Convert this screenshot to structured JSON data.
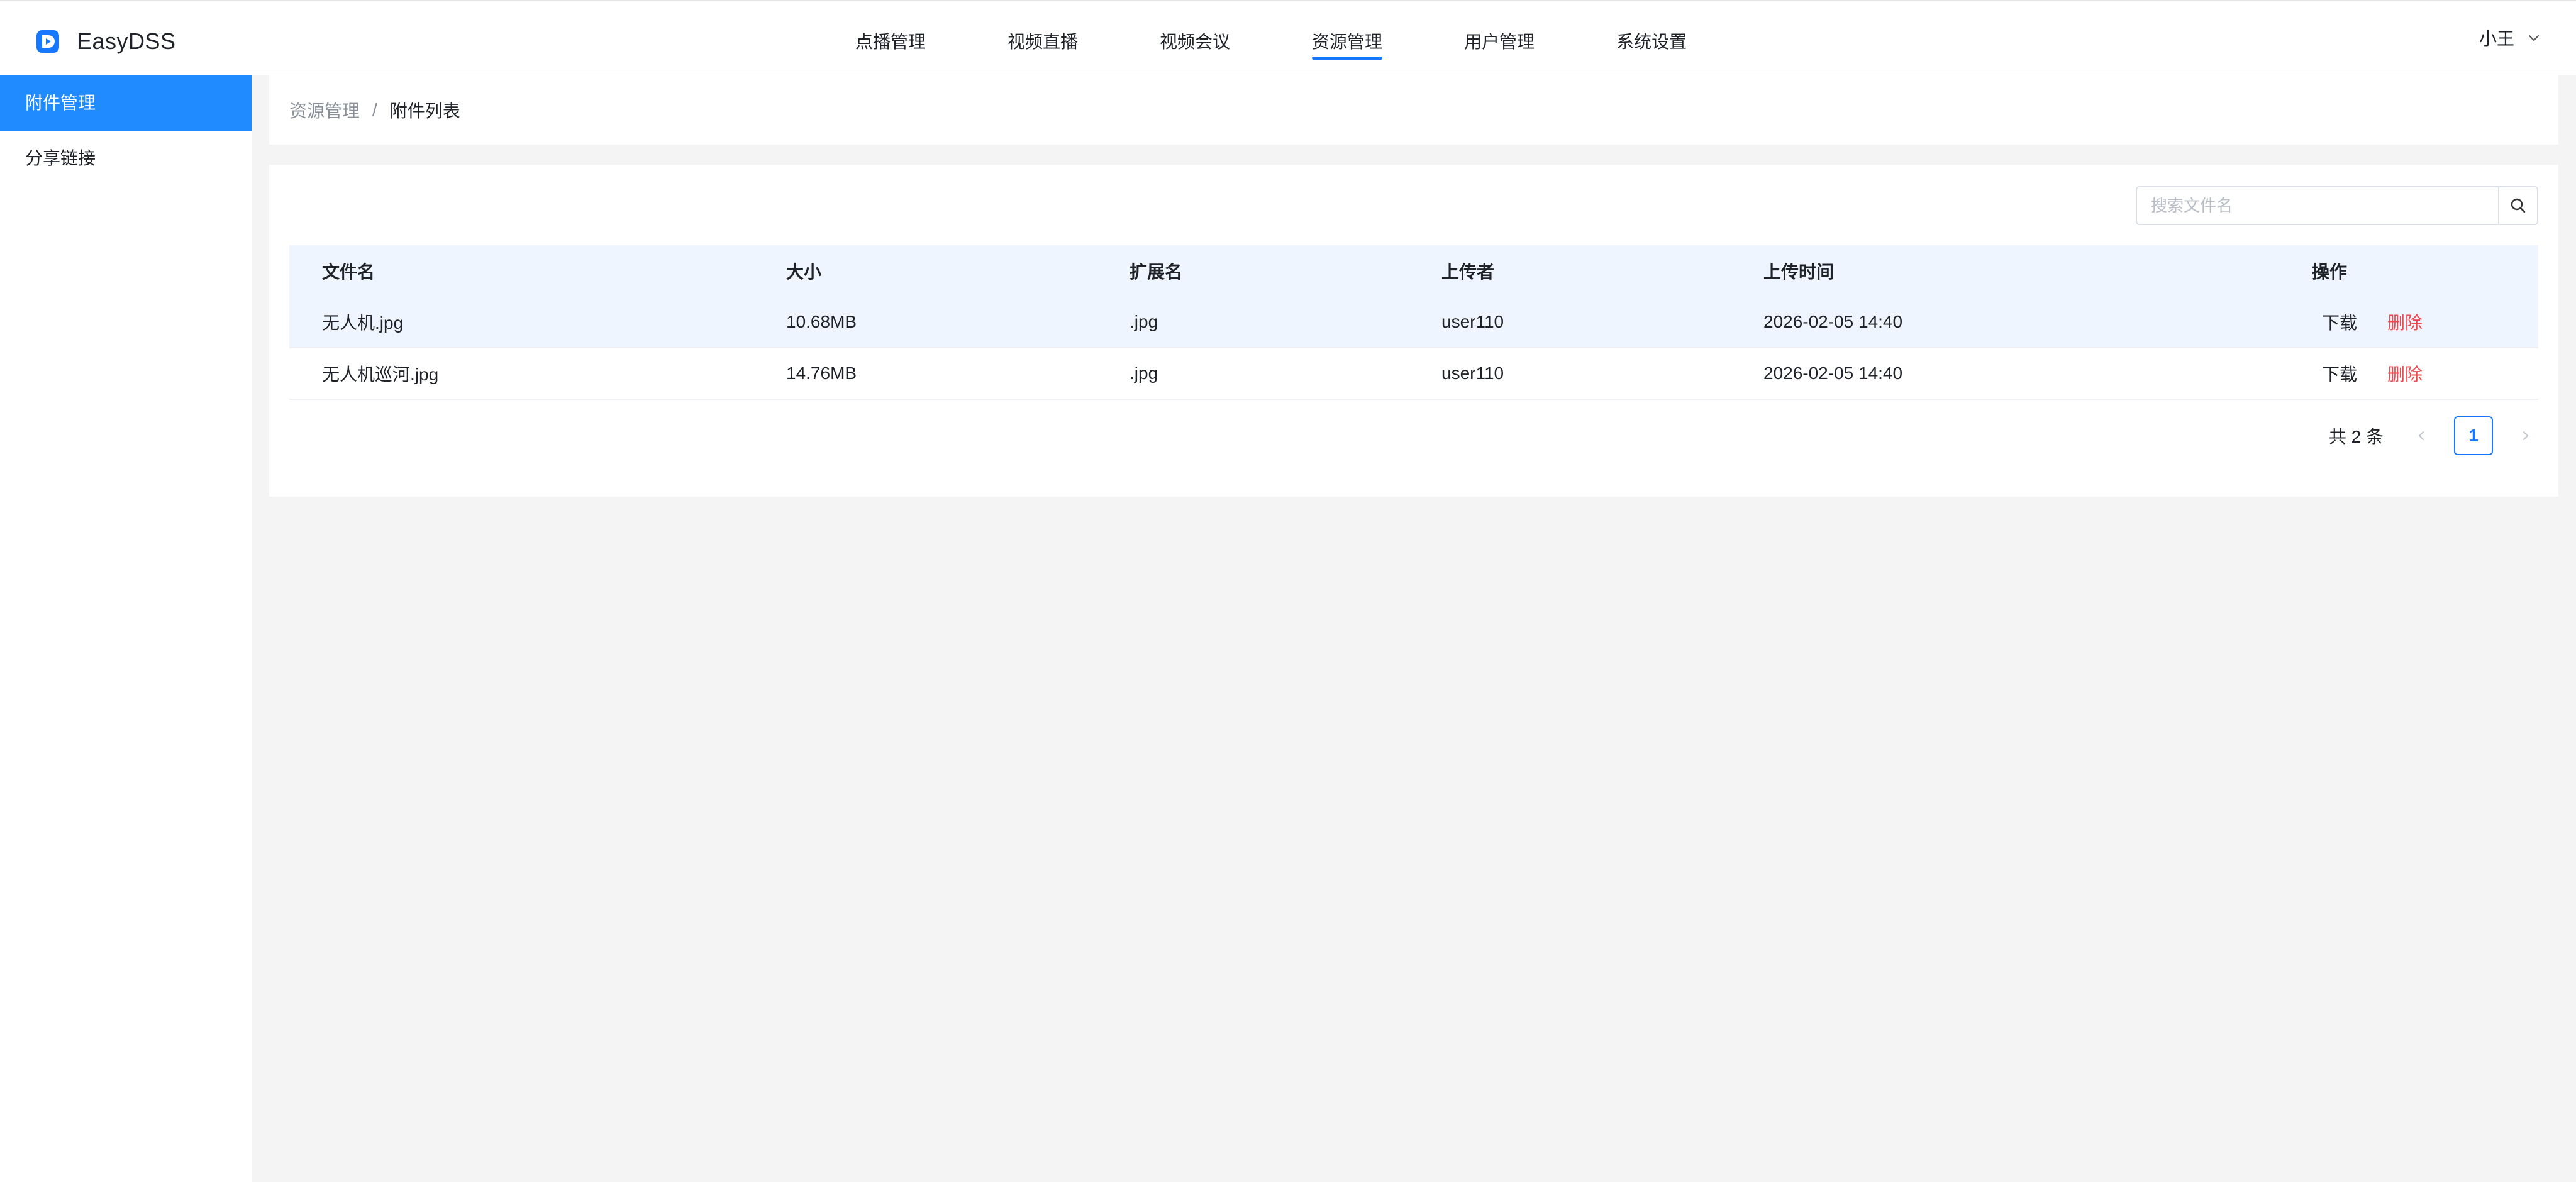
{
  "app": {
    "name": "EasyDSS",
    "accent_color": "#1677ff",
    "logo_icon": "play-logo-icon"
  },
  "top_nav": {
    "items": [
      {
        "label": "点播管理"
      },
      {
        "label": "视频直播"
      },
      {
        "label": "视频会议"
      },
      {
        "label": "资源管理",
        "active": true
      },
      {
        "label": "用户管理"
      },
      {
        "label": "系统设置"
      }
    ],
    "user": "小王"
  },
  "sidebar": {
    "items": [
      {
        "label": "附件管理",
        "active": true
      },
      {
        "label": "分享链接"
      }
    ]
  },
  "breadcrumb": {
    "parent": "资源管理",
    "separator": "/",
    "current": "附件列表"
  },
  "search": {
    "placeholder": "搜索文件名",
    "value": ""
  },
  "table": {
    "columns": [
      "文件名",
      "大小",
      "扩展名",
      "上传者",
      "上传时间",
      "操作"
    ],
    "rows": [
      {
        "name": "无人机.jpg",
        "size": "10.68MB",
        "ext": ".jpg",
        "uploader": "user110",
        "time": "2026-02-05 14:40",
        "download": "下载",
        "delete": "删除"
      },
      {
        "name": "无人机巡河.jpg",
        "size": "14.76MB",
        "ext": ".jpg",
        "uploader": "user110",
        "time": "2026-02-05 14:40",
        "download": "下载",
        "delete": "删除"
      }
    ]
  },
  "pagination": {
    "total_text": "共 2 条",
    "current_page": "1"
  }
}
